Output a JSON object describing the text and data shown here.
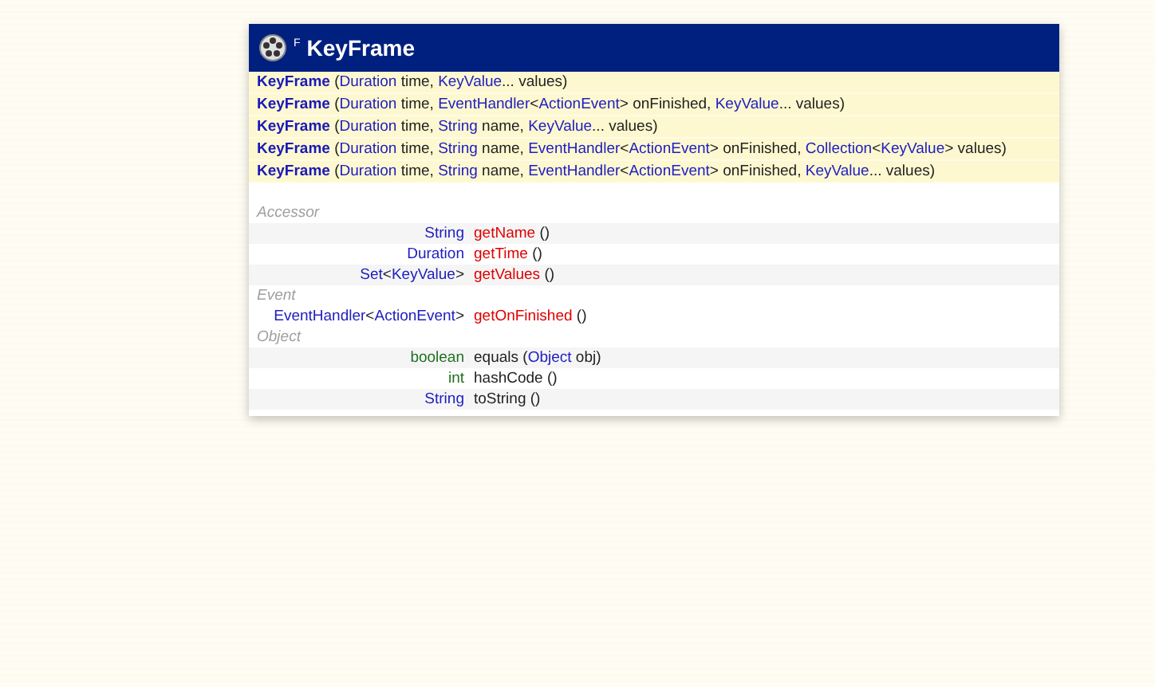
{
  "header": {
    "badge": "F",
    "title": "KeyFrame"
  },
  "constructors": [
    [
      {
        "kind": "name",
        "text": "KeyFrame"
      },
      {
        "kind": "plain",
        "text": " ("
      },
      {
        "kind": "type",
        "text": "Duration"
      },
      {
        "kind": "plain",
        "text": " time, "
      },
      {
        "kind": "type",
        "text": "KeyValue"
      },
      {
        "kind": "plain",
        "text": "... values)"
      }
    ],
    [
      {
        "kind": "name",
        "text": "KeyFrame"
      },
      {
        "kind": "plain",
        "text": " ("
      },
      {
        "kind": "type",
        "text": "Duration"
      },
      {
        "kind": "plain",
        "text": " time, "
      },
      {
        "kind": "type",
        "text": "EventHandler"
      },
      {
        "kind": "plain",
        "text": "<"
      },
      {
        "kind": "type",
        "text": "ActionEvent"
      },
      {
        "kind": "plain",
        "text": "> onFinished, "
      },
      {
        "kind": "type",
        "text": "KeyValue"
      },
      {
        "kind": "plain",
        "text": "... values)"
      }
    ],
    [
      {
        "kind": "name",
        "text": "KeyFrame"
      },
      {
        "kind": "plain",
        "text": " ("
      },
      {
        "kind": "type",
        "text": "Duration"
      },
      {
        "kind": "plain",
        "text": " time, "
      },
      {
        "kind": "type",
        "text": "String"
      },
      {
        "kind": "plain",
        "text": " name, "
      },
      {
        "kind": "type",
        "text": "KeyValue"
      },
      {
        "kind": "plain",
        "text": "... values)"
      }
    ],
    [
      {
        "kind": "name",
        "text": "KeyFrame"
      },
      {
        "kind": "plain",
        "text": " ("
      },
      {
        "kind": "type",
        "text": "Duration"
      },
      {
        "kind": "plain",
        "text": " time, "
      },
      {
        "kind": "type",
        "text": "String"
      },
      {
        "kind": "plain",
        "text": " name, "
      },
      {
        "kind": "type",
        "text": "EventHandler"
      },
      {
        "kind": "plain",
        "text": "<"
      },
      {
        "kind": "type",
        "text": "ActionEvent"
      },
      {
        "kind": "plain",
        "text": "> onFinished, "
      },
      {
        "kind": "type",
        "text": "Collection"
      },
      {
        "kind": "plain",
        "text": "<"
      },
      {
        "kind": "type",
        "text": "KeyValue"
      },
      {
        "kind": "plain",
        "text": "> values)"
      }
    ],
    [
      {
        "kind": "name",
        "text": "KeyFrame"
      },
      {
        "kind": "plain",
        "text": " ("
      },
      {
        "kind": "type",
        "text": "Duration"
      },
      {
        "kind": "plain",
        "text": " time, "
      },
      {
        "kind": "type",
        "text": "String"
      },
      {
        "kind": "plain",
        "text": " name, "
      },
      {
        "kind": "type",
        "text": "EventHandler"
      },
      {
        "kind": "plain",
        "text": "<"
      },
      {
        "kind": "type",
        "text": "ActionEvent"
      },
      {
        "kind": "plain",
        "text": "> onFinished, "
      },
      {
        "kind": "type",
        "text": "KeyValue"
      },
      {
        "kind": "plain",
        "text": "... values)"
      }
    ]
  ],
  "groups": [
    {
      "label": "Accessor",
      "methods": [
        {
          "returns": [
            {
              "kind": "type",
              "text": "String"
            }
          ],
          "signature": [
            {
              "kind": "method",
              "text": "getName"
            },
            {
              "kind": "plain",
              "text": " ()"
            }
          ]
        },
        {
          "returns": [
            {
              "kind": "type",
              "text": "Duration"
            }
          ],
          "signature": [
            {
              "kind": "method",
              "text": "getTime"
            },
            {
              "kind": "plain",
              "text": " ()"
            }
          ]
        },
        {
          "returns": [
            {
              "kind": "type",
              "text": "Set"
            },
            {
              "kind": "plain",
              "text": "<"
            },
            {
              "kind": "type",
              "text": "KeyValue"
            },
            {
              "kind": "plain",
              "text": ">"
            }
          ],
          "signature": [
            {
              "kind": "method",
              "text": "getValues"
            },
            {
              "kind": "plain",
              "text": " ()"
            }
          ]
        }
      ]
    },
    {
      "label": "Event",
      "methods": [
        {
          "returns": [
            {
              "kind": "type",
              "text": "EventHandler"
            },
            {
              "kind": "plain",
              "text": "<"
            },
            {
              "kind": "type",
              "text": "ActionEvent"
            },
            {
              "kind": "plain",
              "text": ">"
            }
          ],
          "signature": [
            {
              "kind": "method",
              "text": "getOnFinished"
            },
            {
              "kind": "plain",
              "text": " ()"
            }
          ]
        }
      ]
    },
    {
      "label": "Object",
      "methods": [
        {
          "returns": [
            {
              "kind": "primitive",
              "text": "boolean"
            }
          ],
          "signature": [
            {
              "kind": "plain",
              "text": "equals ("
            },
            {
              "kind": "type",
              "text": "Object"
            },
            {
              "kind": "plain",
              "text": " obj)"
            }
          ]
        },
        {
          "returns": [
            {
              "kind": "primitive",
              "text": "int"
            }
          ],
          "signature": [
            {
              "kind": "plain",
              "text": "hashCode ()"
            }
          ]
        },
        {
          "returns": [
            {
              "kind": "type",
              "text": "String"
            }
          ],
          "signature": [
            {
              "kind": "plain",
              "text": "toString ()"
            }
          ]
        }
      ]
    }
  ]
}
